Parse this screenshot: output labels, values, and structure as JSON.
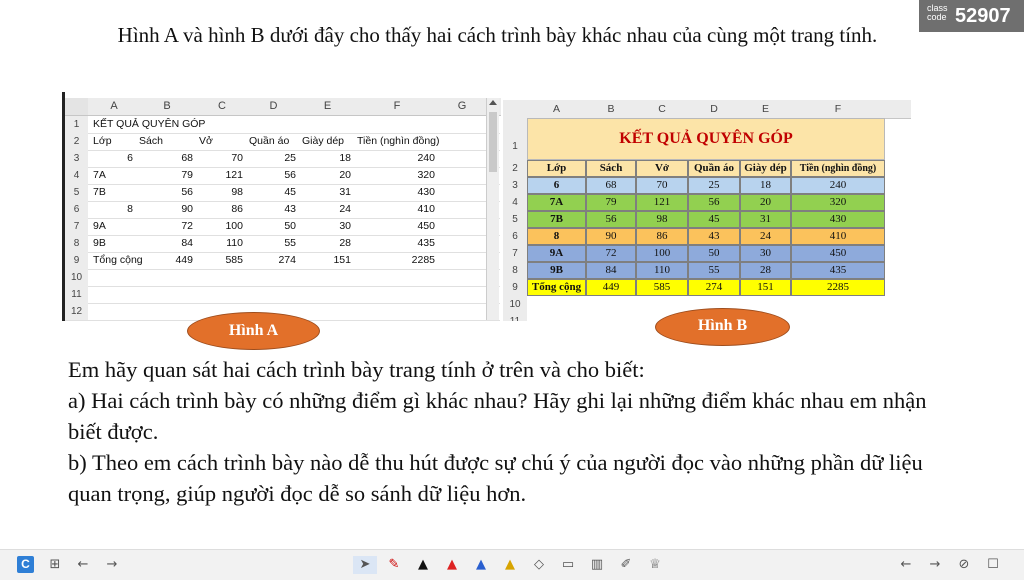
{
  "badge": {
    "label1": "class",
    "label2": "code",
    "code": "52907"
  },
  "title": "Hình A và hình B dưới đây cho thấy hai cách trình bày khác nhau của cùng một trang tính.",
  "sheet_a": {
    "columns": [
      "A",
      "B",
      "C",
      "D",
      "E",
      "F",
      "G"
    ],
    "rows": [
      {
        "n": "1",
        "cells": [
          "KẾT QUẢ QUYÊN GÓP",
          "",
          "",
          "",
          "",
          ""
        ]
      },
      {
        "n": "2",
        "cells": [
          "Lớp",
          "Sách",
          "Vở",
          "Quần áo",
          "Giày dép",
          "Tiền (nghìn đồng)"
        ]
      },
      {
        "n": "3",
        "cells": [
          "6",
          "68",
          "70",
          "25",
          "18",
          "240"
        ]
      },
      {
        "n": "4",
        "cells": [
          "7A",
          "79",
          "121",
          "56",
          "20",
          "320"
        ]
      },
      {
        "n": "5",
        "cells": [
          "7B",
          "56",
          "98",
          "45",
          "31",
          "430"
        ]
      },
      {
        "n": "6",
        "cells": [
          "8",
          "90",
          "86",
          "43",
          "24",
          "410"
        ]
      },
      {
        "n": "7",
        "cells": [
          "9A",
          "72",
          "100",
          "50",
          "30",
          "450"
        ]
      },
      {
        "n": "8",
        "cells": [
          "9B",
          "84",
          "110",
          "55",
          "28",
          "435"
        ]
      },
      {
        "n": "9",
        "cells": [
          "Tổng cộng",
          "449",
          "585",
          "274",
          "151",
          "2285"
        ]
      },
      {
        "n": "10",
        "cells": [
          "",
          "",
          "",
          "",
          "",
          ""
        ]
      },
      {
        "n": "11",
        "cells": [
          "",
          "",
          "",
          "",
          "",
          ""
        ]
      },
      {
        "n": "12",
        "cells": [
          "",
          "",
          "",
          "",
          "",
          ""
        ]
      }
    ]
  },
  "sheet_b": {
    "columns": [
      "A",
      "B",
      "C",
      "D",
      "E",
      "F"
    ],
    "title": "KẾT QUẢ QUYÊN GÓP",
    "row_numbers": [
      "1",
      "2",
      "3",
      "4",
      "5",
      "6",
      "7",
      "8",
      "9",
      "10",
      "11"
    ],
    "header": [
      "Lớp",
      "Sách",
      "Vở",
      "Quần áo",
      "Giày dép",
      "Tiền (nghìn đồng)"
    ],
    "rows": [
      {
        "cells": [
          "6",
          "68",
          "70",
          "25",
          "18",
          "240"
        ],
        "color": "#b8d3ee"
      },
      {
        "cells": [
          "7A",
          "79",
          "121",
          "56",
          "20",
          "320"
        ],
        "color": "#92d050"
      },
      {
        "cells": [
          "7B",
          "56",
          "98",
          "45",
          "31",
          "430"
        ],
        "color": "#92d050"
      },
      {
        "cells": [
          "8",
          "90",
          "86",
          "43",
          "24",
          "410"
        ],
        "color": "#fbc25c"
      },
      {
        "cells": [
          "9A",
          "72",
          "100",
          "50",
          "30",
          "450"
        ],
        "color": "#8eaadb"
      },
      {
        "cells": [
          "9B",
          "84",
          "110",
          "55",
          "28",
          "435"
        ],
        "color": "#8eaadb"
      },
      {
        "cells": [
          "Tổng cộng",
          "449",
          "585",
          "274",
          "151",
          "2285"
        ],
        "color": "#ffff00"
      }
    ]
  },
  "labels": {
    "a": "Hình A",
    "b": "Hình B"
  },
  "body": [
    "Em hãy quan sát hai cách trình bày trang tính ở trên và cho biết:",
    "a) Hai cách trình bày có những điểm gì khác nhau? Hãy ghi lại những điểm khác nhau em nhận biết được.",
    "b) Theo em cách trình bày nào dễ thu hút được sự chú ý của người đọc vào những phần dữ liệu quan trọng, giúp người đọc dễ so sánh dữ liệu hơn."
  ],
  "taskbar": {
    "app_letter": "C",
    "left_icons": [
      "grid-icon",
      "back-arrow-icon",
      "forward-arrow-icon"
    ],
    "tools": [
      "pointer-icon",
      "laser-icon",
      "pen-black-icon",
      "pen-red-icon",
      "pen-blue-icon",
      "highlighter-icon",
      "eraser-icon",
      "whiteboard-icon",
      "chart-icon",
      "clipboard-icon",
      "trophy-icon"
    ],
    "right_icons": [
      "prev-page-icon",
      "next-page-icon",
      "hide-icon",
      "settings-icon"
    ]
  }
}
